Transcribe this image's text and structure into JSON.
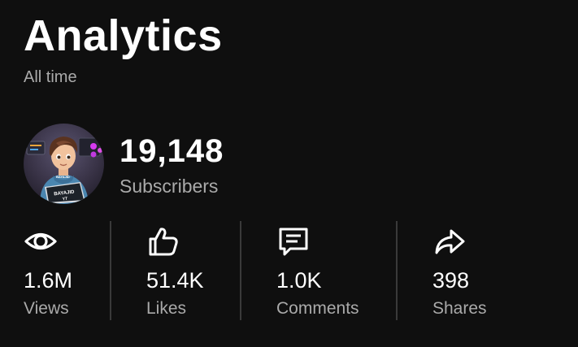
{
  "header": {
    "title": "Analytics",
    "subtitle": "All time"
  },
  "channel": {
    "avatar_text_line1": "BAYAJID",
    "avatar_text_line2": "YT",
    "subscriber_count": "19,148",
    "subscriber_label": "Subscribers"
  },
  "stats": [
    {
      "icon": "eye-icon",
      "value": "1.6M",
      "label": "Views"
    },
    {
      "icon": "thumbs-up-icon",
      "value": "51.4K",
      "label": "Likes"
    },
    {
      "icon": "comment-icon",
      "value": "1.0K",
      "label": "Comments"
    },
    {
      "icon": "share-icon",
      "value": "398",
      "label": "Shares"
    }
  ],
  "colors": {
    "background": "#0f0f0f",
    "primary_text": "#ffffff",
    "secondary_text": "#aaaaaa",
    "divider": "#3a3a3a"
  }
}
